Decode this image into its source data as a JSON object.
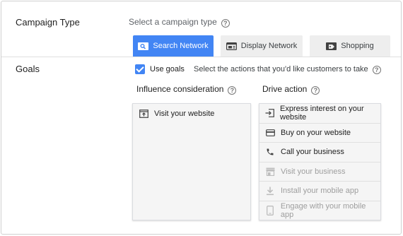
{
  "campaign_type": {
    "label": "Campaign Type",
    "hint": "Select a campaign type",
    "tabs": [
      {
        "label": "Search Network",
        "icon": "search-network-icon",
        "active": true
      },
      {
        "label": "Display Network",
        "icon": "display-network-icon",
        "active": false
      },
      {
        "label": "Shopping",
        "icon": "shopping-tag-icon",
        "active": false
      }
    ]
  },
  "goals": {
    "label": "Goals",
    "use_goals_label": "Use goals",
    "use_goals_checked": true,
    "instruction": "Select the actions that you'd like customers to take",
    "influence": {
      "heading": "Influence consideration",
      "items": [
        {
          "label": "Visit your website",
          "icon": "visit-website-icon",
          "enabled": true
        }
      ]
    },
    "drive": {
      "heading": "Drive action",
      "items": [
        {
          "label": "Express interest on your website",
          "icon": "express-interest-icon",
          "enabled": true
        },
        {
          "label": "Buy on your website",
          "icon": "credit-card-icon",
          "enabled": true
        },
        {
          "label": "Call your business",
          "icon": "phone-icon",
          "enabled": true
        },
        {
          "label": "Visit your business",
          "icon": "store-icon",
          "enabled": false
        },
        {
          "label": "Install your mobile app",
          "icon": "download-icon",
          "enabled": false
        },
        {
          "label": "Engage with your mobile app",
          "icon": "mobile-icon",
          "enabled": false
        }
      ]
    }
  },
  "colors": {
    "accent": "#4285f4",
    "disabled_text": "#9e9e9e",
    "panel_bg": "#f5f5f5"
  }
}
